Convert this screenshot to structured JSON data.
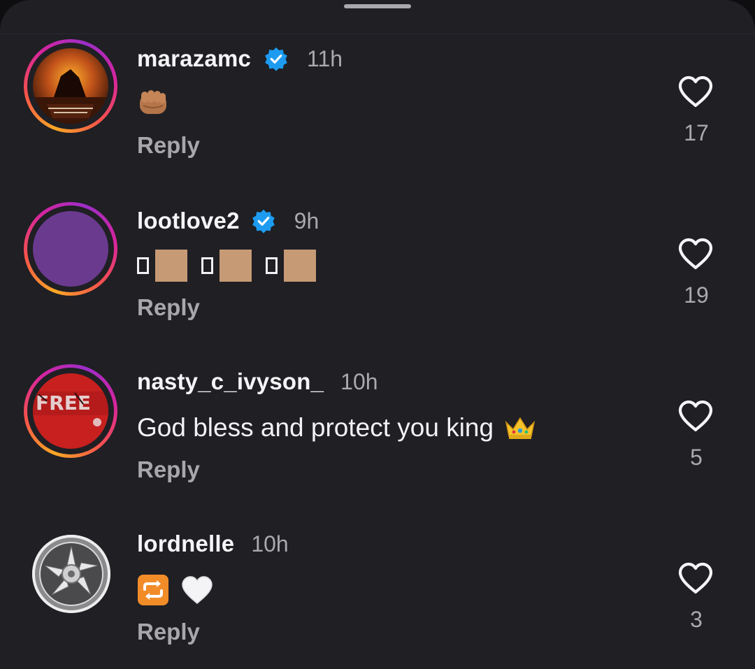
{
  "sheet": {
    "handle_icon": "drag-handle"
  },
  "comments": [
    {
      "username": "marazamc",
      "verified": true,
      "time": "11h",
      "text_emoji": "fist-emoji",
      "reply_label": "Reply",
      "likes": "17",
      "avatar": "photo-dark-orange-ring-story"
    },
    {
      "username": "lootlove2",
      "verified": true,
      "time": "9h",
      "text_emoji": "missing-glyph-and-skin-tone-squares",
      "reply_label": "Reply",
      "likes": "19",
      "avatar": "solid-purple-ring-story"
    },
    {
      "username": "nasty_c_ivyson_",
      "verified": false,
      "time": "10h",
      "text": "God bless and protect you king",
      "text_emoji": "crown-emoji",
      "reply_label": "Reply",
      "likes": "5",
      "avatar": "red-free-graphic-ring-story"
    },
    {
      "username": "lordnelle",
      "verified": false,
      "time": "10h",
      "text_emoji": "repeat-emoji white-heart-emoji",
      "reply_label": "Reply",
      "likes": "3",
      "avatar": "chrome-wheel-no-ring"
    }
  ],
  "colors": {
    "background": "#1f1f24",
    "verified_blue": "#1d9bf0",
    "secondary_text": "#a9a9ae",
    "ring_gradient": [
      "#f9a825",
      "#f5524b",
      "#d6249f",
      "#9b2fc7"
    ]
  }
}
